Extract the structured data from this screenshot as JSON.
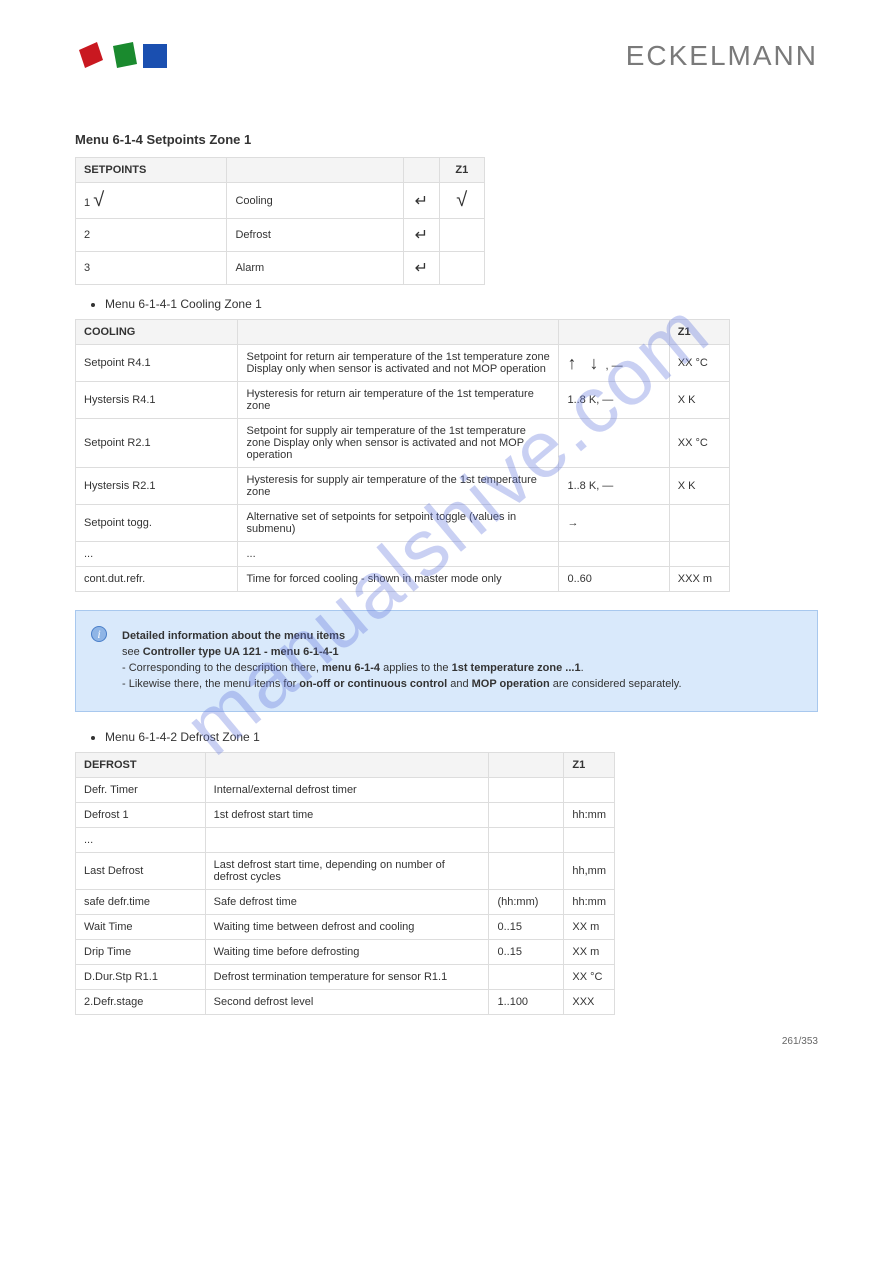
{
  "watermark": "manualshive.com",
  "brand": "ECKELMANN",
  "section_title": "Menu 6-1-4 Setpoints Zone 1",
  "table1": {
    "headers": [
      "SETPOINTS",
      "Z1"
    ],
    "rows": [
      [
        "1",
        "Cooling",
        "→",
        "√"
      ],
      [
        "2",
        "Defrost",
        "→",
        ""
      ],
      [
        "3",
        "Alarm",
        "→",
        ""
      ]
    ]
  },
  "bullet1": "Menu 6-1-4-1 Cooling Zone 1",
  "table2": {
    "headers": [
      "COOLING",
      "Z1"
    ],
    "rows": [
      [
        "Setpoint R4.1",
        "Setpoint for return air temperature of the 1st temperature zone Display only when sensor is activated and not MOP operation",
        "↑ ↓ , —",
        "XX °C"
      ],
      [
        "Hystersis R4.1",
        "Hysteresis for return air temperature of the 1st temperature zone",
        "1..8 K, —",
        "X K"
      ],
      [
        "Setpoint R2.1",
        "Setpoint for supply air temperature of the 1st temperature zone Display only when sensor is activated and not MOP operation",
        "",
        "XX °C"
      ],
      [
        "Hystersis R2.1",
        "Hysteresis for supply air temperature of the 1st temperature zone",
        "1..8 K, —",
        "X K"
      ],
      [
        "Setpoint togg.",
        "Alternative set of setpoints for setpoint toggle (values in submenu)",
        "→",
        ""
      ],
      [
        "...",
        "...",
        "",
        ""
      ],
      [
        "cont.dut.refr.",
        "Time for forced cooling - shown in master mode only",
        "0..60",
        "XXX m"
      ]
    ]
  },
  "info_box": "Detailed information about the menu items\nsee Controller type UA 121 - menu 6-1-4-1\n- Corresponding to the description there, menu 6-1-4 applies to the 1st temperature zone ...1.\n- Likewise there, the menu items for on-off or continuous control and MOP operation are considered separately.",
  "bullet2": "Menu 6-1-4-2 Defrost Zone 1",
  "table3": {
    "headers": [
      "DEFROST",
      "Z1"
    ],
    "rows": [
      [
        "Defr. Timer",
        "Internal/external defrost timer",
        "",
        ""
      ],
      [
        "Defrost 1",
        "1st defrost start time",
        "",
        "hh:mm"
      ],
      [
        "...",
        "",
        "",
        ""
      ],
      [
        "Last Defrost",
        "Last defrost start time, depending on number of defrost cycles",
        "",
        "hh,mm"
      ],
      [
        "safe defr.time",
        "Safe defrost time",
        "(hh:mm)",
        "hh:mm"
      ],
      [
        "Wait Time",
        "Waiting time between defrost and cooling",
        "0..15",
        "XX m"
      ],
      [
        "Drip Time",
        "Waiting time before defrosting",
        "0..15",
        "XX m"
      ],
      [
        "D.Dur.Stp R1.1",
        "Defrost termination temperature for sensor R1.1",
        "",
        "XX °C"
      ],
      [
        "2.Defr.stage",
        "Second defrost level",
        "1..100",
        "XXX"
      ]
    ]
  },
  "footer": "261/353"
}
